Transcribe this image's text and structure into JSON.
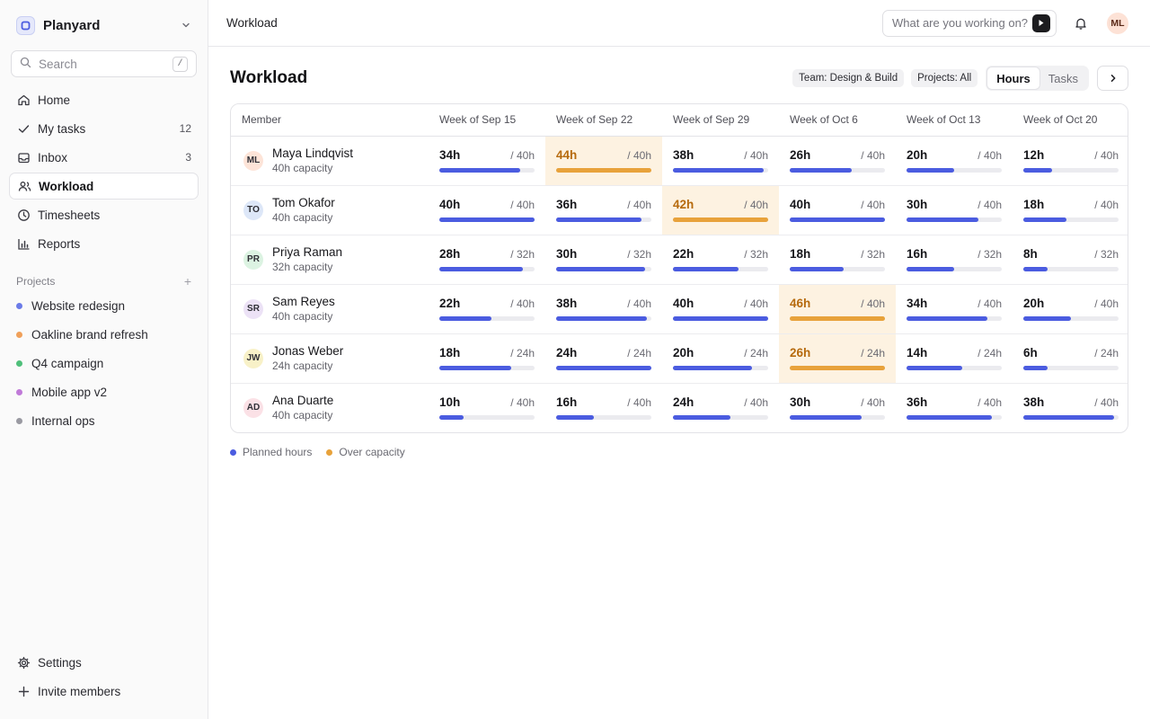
{
  "workspace": {
    "name": "Planyard"
  },
  "search": {
    "placeholder": "Search",
    "shortcut": "/"
  },
  "nav": [
    {
      "id": "home",
      "label": "Home",
      "icon": "home-icon"
    },
    {
      "id": "my-tasks",
      "label": "My tasks",
      "count": "12",
      "icon": "check-icon"
    },
    {
      "id": "inbox",
      "label": "Inbox",
      "count": "3",
      "icon": "inbox-icon"
    },
    {
      "id": "workload",
      "label": "Workload",
      "icon": "users-icon",
      "active": true
    },
    {
      "id": "timesheets",
      "label": "Timesheets",
      "icon": "clock-icon"
    },
    {
      "id": "reports",
      "label": "Reports",
      "icon": "bar-chart-icon"
    }
  ],
  "projects_section": {
    "label": "Projects"
  },
  "projects": [
    {
      "label": "Website redesign",
      "color": "#6b7be8"
    },
    {
      "label": "Oakline brand refresh",
      "color": "#f0a05a"
    },
    {
      "label": "Q4 campaign",
      "color": "#4fbf7a"
    },
    {
      "label": "Mobile app v2",
      "color": "#c07ad8"
    },
    {
      "label": "Internal ops",
      "color": "#9a9aa2"
    }
  ],
  "bottom_nav": [
    {
      "label": "Settings",
      "icon": "gear-icon"
    },
    {
      "label": "Invite members",
      "icon": "plus-icon"
    }
  ],
  "topbar": {
    "breadcrumb": "Workload",
    "command_placeholder": "What are you working on?",
    "user_initials": "ML"
  },
  "page": {
    "title": "Workload",
    "filters": [
      "Team: Design & Build",
      "Projects: All"
    ],
    "view_toggle": [
      "Hours",
      "Tasks"
    ],
    "active_view": "Hours"
  },
  "table": {
    "member_header": "Member",
    "weeks": [
      "Week of Sep 15",
      "Week of Sep 22",
      "Week of Sep 29",
      "Week of Oct 6",
      "Week of Oct 13",
      "Week of Oct 20"
    ],
    "rows": [
      {
        "initials": "ML",
        "name": "Maya Lindqvist",
        "capacity_label": "40h capacity",
        "avatar_color": "#fde4d8",
        "cells": [
          {
            "hours": "34h",
            "cap": "/ 40h",
            "pct": 85
          },
          {
            "hours": "44h",
            "cap": "/ 40h",
            "pct": 100,
            "over": true
          },
          {
            "hours": "38h",
            "cap": "/ 40h",
            "pct": 95
          },
          {
            "hours": "26h",
            "cap": "/ 40h",
            "pct": 65
          },
          {
            "hours": "20h",
            "cap": "/ 40h",
            "pct": 50
          },
          {
            "hours": "12h",
            "cap": "/ 40h",
            "pct": 30
          }
        ]
      },
      {
        "initials": "TO",
        "name": "Tom Okafor",
        "capacity_label": "40h capacity",
        "avatar_color": "#dde7f8",
        "cells": [
          {
            "hours": "40h",
            "cap": "/ 40h",
            "pct": 100
          },
          {
            "hours": "36h",
            "cap": "/ 40h",
            "pct": 90
          },
          {
            "hours": "42h",
            "cap": "/ 40h",
            "pct": 100,
            "over": true
          },
          {
            "hours": "40h",
            "cap": "/ 40h",
            "pct": 100
          },
          {
            "hours": "30h",
            "cap": "/ 40h",
            "pct": 75
          },
          {
            "hours": "18h",
            "cap": "/ 40h",
            "pct": 45
          }
        ]
      },
      {
        "initials": "PR",
        "name": "Priya Raman",
        "capacity_label": "32h capacity",
        "avatar_color": "#dcf3e2",
        "cells": [
          {
            "hours": "28h",
            "cap": "/ 32h",
            "pct": 87.5
          },
          {
            "hours": "30h",
            "cap": "/ 32h",
            "pct": 93.75
          },
          {
            "hours": "22h",
            "cap": "/ 32h",
            "pct": 68.75
          },
          {
            "hours": "18h",
            "cap": "/ 32h",
            "pct": 56.25
          },
          {
            "hours": "16h",
            "cap": "/ 32h",
            "pct": 50
          },
          {
            "hours": "8h",
            "cap": "/ 32h",
            "pct": 25
          }
        ]
      },
      {
        "initials": "SR",
        "name": "Sam Reyes",
        "capacity_label": "40h capacity",
        "avatar_color": "#ece2f6",
        "cells": [
          {
            "hours": "22h",
            "cap": "/ 40h",
            "pct": 55
          },
          {
            "hours": "38h",
            "cap": "/ 40h",
            "pct": 95
          },
          {
            "hours": "40h",
            "cap": "/ 40h",
            "pct": 100
          },
          {
            "hours": "46h",
            "cap": "/ 40h",
            "pct": 100,
            "over": true
          },
          {
            "hours": "34h",
            "cap": "/ 40h",
            "pct": 85
          },
          {
            "hours": "20h",
            "cap": "/ 40h",
            "pct": 50
          }
        ]
      },
      {
        "initials": "JW",
        "name": "Jonas Weber",
        "capacity_label": "24h capacity",
        "avatar_color": "#f8f1c8",
        "cells": [
          {
            "hours": "18h",
            "cap": "/ 24h",
            "pct": 75
          },
          {
            "hours": "24h",
            "cap": "/ 24h",
            "pct": 100
          },
          {
            "hours": "20h",
            "cap": "/ 24h",
            "pct": 83.33
          },
          {
            "hours": "26h",
            "cap": "/ 24h",
            "pct": 100,
            "over": true
          },
          {
            "hours": "14h",
            "cap": "/ 24h",
            "pct": 58.33
          },
          {
            "hours": "6h",
            "cap": "/ 24h",
            "pct": 25
          }
        ]
      },
      {
        "initials": "AD",
        "name": "Ana Duarte",
        "capacity_label": "40h capacity",
        "avatar_color": "#fbe1e6",
        "cells": [
          {
            "hours": "10h",
            "cap": "/ 40h",
            "pct": 25
          },
          {
            "hours": "16h",
            "cap": "/ 40h",
            "pct": 40
          },
          {
            "hours": "24h",
            "cap": "/ 40h",
            "pct": 60
          },
          {
            "hours": "30h",
            "cap": "/ 40h",
            "pct": 75
          },
          {
            "hours": "36h",
            "cap": "/ 40h",
            "pct": 90
          },
          {
            "hours": "38h",
            "cap": "/ 40h",
            "pct": 95
          }
        ]
      }
    ]
  },
  "legend": [
    {
      "label": "Planned hours",
      "color": "#4b5ce0"
    },
    {
      "label": "Over capacity",
      "color": "#e8a23b"
    }
  ]
}
